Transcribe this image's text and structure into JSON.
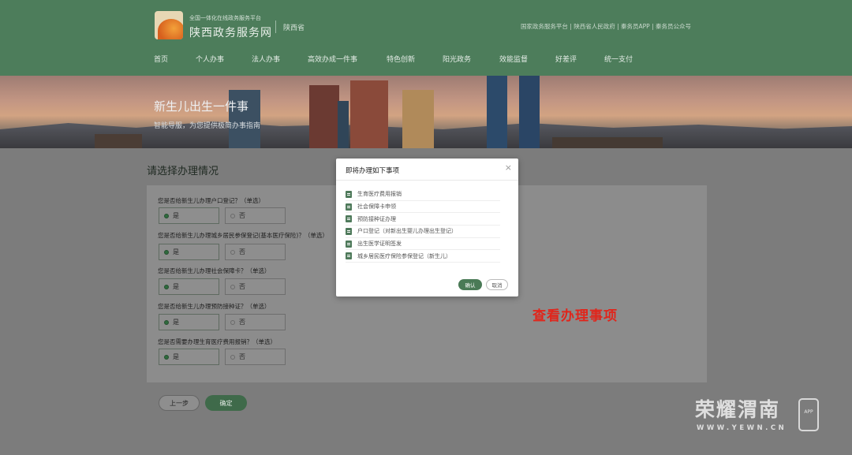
{
  "header": {
    "slogan": "全国一体化在线政务服务平台",
    "site_name": "陕西政务服务网",
    "province": "陕西省",
    "top_links": "国家政务服务平台 | 陕西省人民政府 | 秦务员APP | 秦务员公众号",
    "nav": [
      "首页",
      "个人办事",
      "法人办事",
      "高效办成一件事",
      "特色创新",
      "阳光政务",
      "效能监督",
      "好差评",
      "统一支付"
    ]
  },
  "banner": {
    "title": "新生儿出生一件事",
    "subtitle": "智能导服，为您提供极简办事指南"
  },
  "form": {
    "title": "请选择办理情况",
    "questions": [
      {
        "text": "您是否给新生儿办理户口登记？（单选）",
        "yes": "是",
        "no": "否",
        "selected": "yes"
      },
      {
        "text": "您是否给新生儿办理城乡居民参保登记(基本医疗保险)？（单选）",
        "yes": "是",
        "no": "否",
        "selected": "yes"
      },
      {
        "text": "您是否给新生儿办理社会保障卡？（单选）",
        "yes": "是",
        "no": "否",
        "selected": "yes"
      },
      {
        "text": "您是否给新生儿办理预防接种证？（单选）",
        "yes": "是",
        "no": "否",
        "selected": "yes"
      },
      {
        "text": "您是否需要办理生育医疗费用报销？（单选）",
        "yes": "是",
        "no": "否",
        "selected": "yes"
      }
    ],
    "prev_label": "上一步",
    "confirm_label": "确定"
  },
  "modal": {
    "title": "即将办理如下事项",
    "items": [
      "生育医疗费用报销",
      "社会保障卡申领",
      "预防接种证办理",
      "户口登记（对新出生婴儿办理出生登记）",
      "出生医学证明签发",
      "城乡居民医疗保险参保登记（新生儿）"
    ],
    "confirm_label": "确认",
    "cancel_label": "取消"
  },
  "annotation": "查看办理事项",
  "watermark": {
    "brand": "荣耀渭南",
    "badge": "APP",
    "url": "WWW.YEWN.CN"
  },
  "colors": {
    "header_bg": "#4d7d5b",
    "accent": "#3f6a4a",
    "annotation": "#e1251b"
  }
}
